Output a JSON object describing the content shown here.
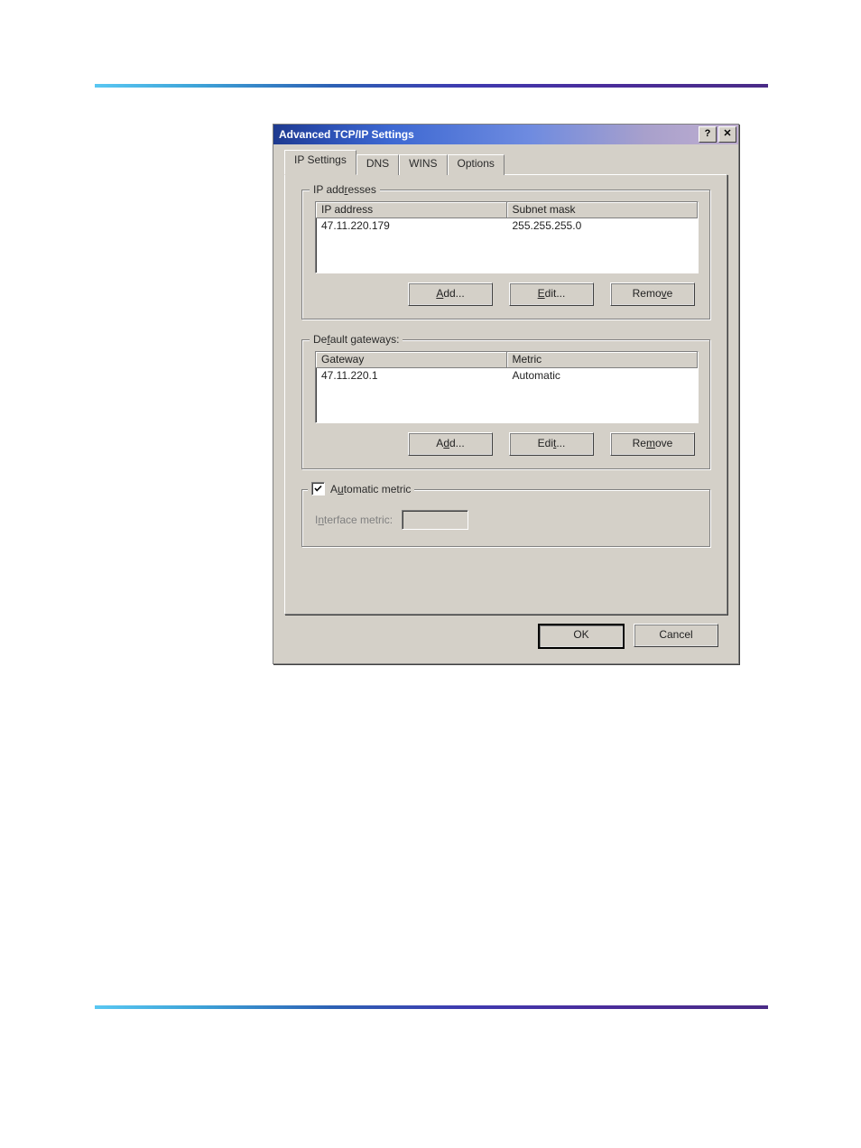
{
  "window": {
    "title": "Advanced TCP/IP Settings"
  },
  "tabs": {
    "t0": "IP Settings",
    "t1": "DNS",
    "t2": "WINS",
    "t3": "Options"
  },
  "ip_group": {
    "legend": "IP addresses",
    "col1": "IP address",
    "col2": "Subnet mask",
    "row1_col1": "47.11.220.179",
    "row1_col2": "255.255.255.0",
    "btn_add": "Add...",
    "btn_edit": "Edit...",
    "btn_remove": "Remove"
  },
  "gw_group": {
    "legend": "Default gateways:",
    "col1": "Gateway",
    "col2": "Metric",
    "row1_col1": "47.11.220.1",
    "row1_col2": "Automatic",
    "btn_add": "Add...",
    "btn_edit": "Edit...",
    "btn_remove": "Remove"
  },
  "metric_group": {
    "check_label": "Automatic metric",
    "checked": true,
    "iface_label": "Interface metric:",
    "iface_value": ""
  },
  "buttons": {
    "ok": "OK",
    "cancel": "Cancel"
  }
}
